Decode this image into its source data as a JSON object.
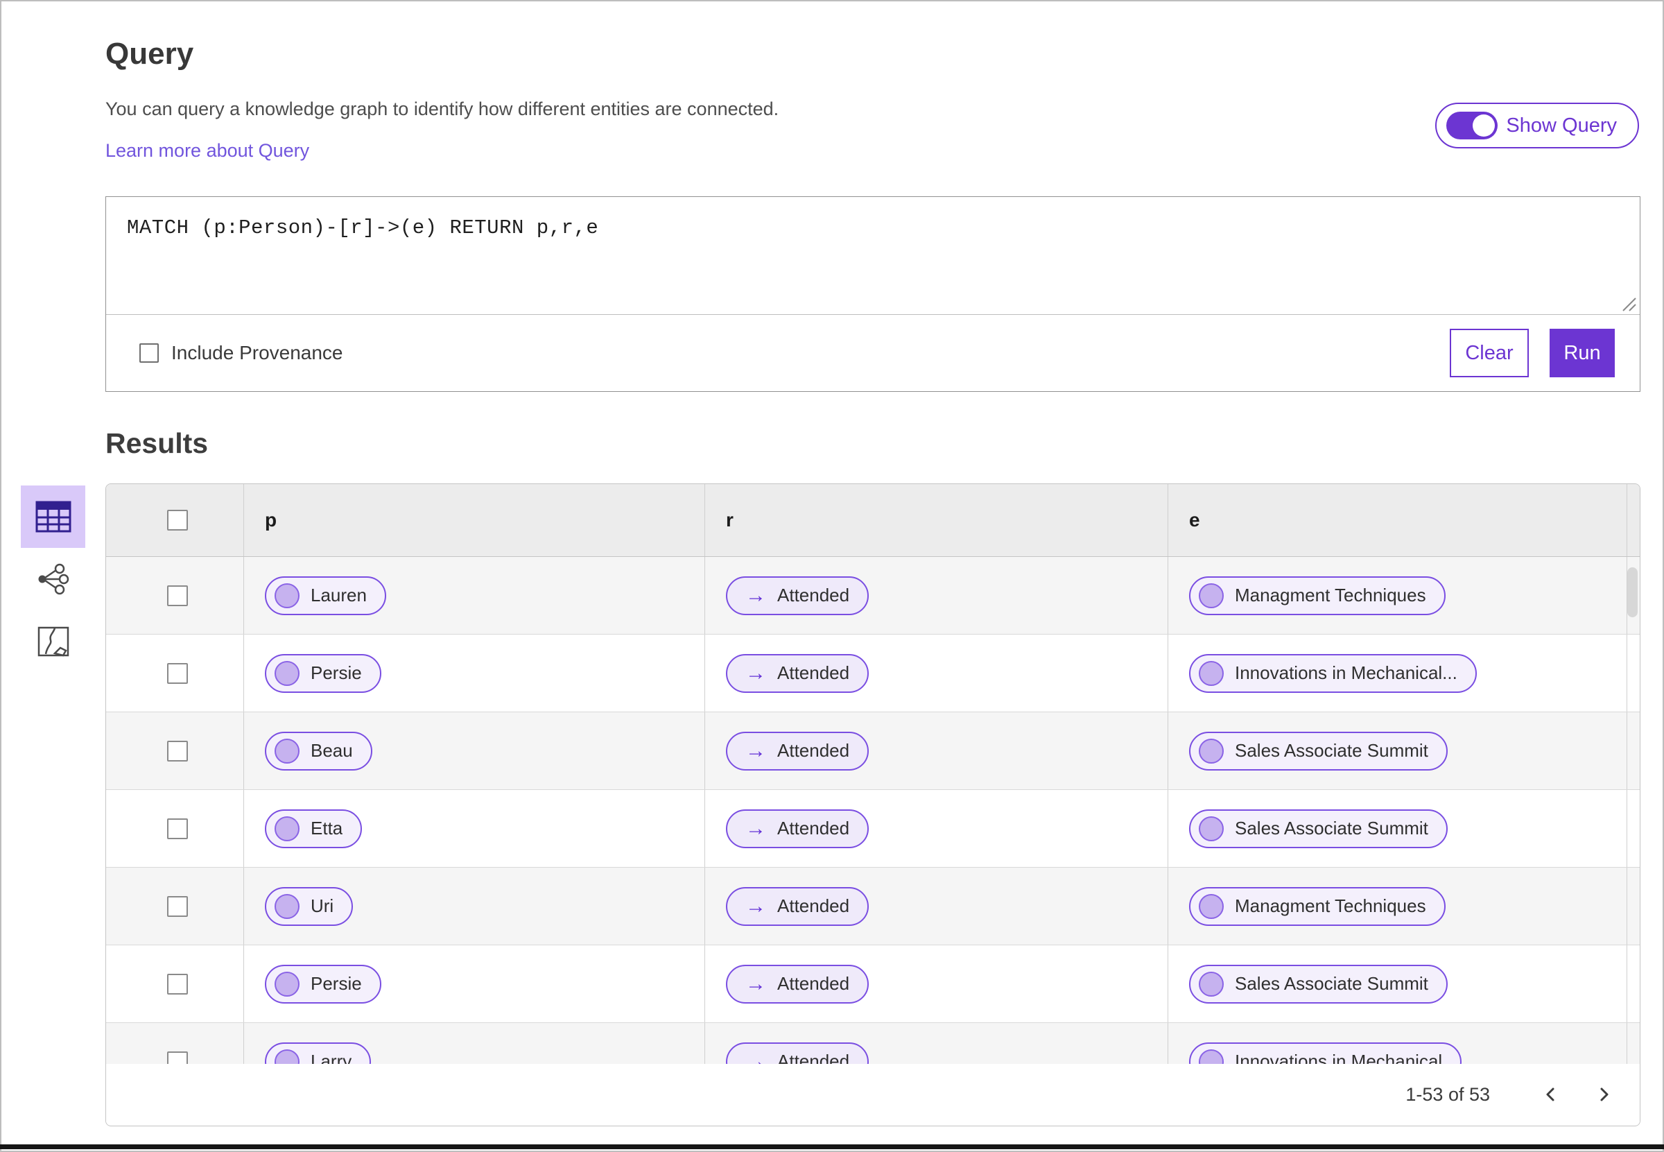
{
  "header": {
    "title": "Query",
    "description": "You can query a knowledge graph to identify how different entities are connected.",
    "learn_more_link": "Learn more about Query",
    "show_query_toggle": {
      "label": "Show Query",
      "state": "on"
    }
  },
  "query_editor": {
    "query_text": "MATCH (p:Person)-[r]->(e) RETURN p,r,e",
    "include_provenance": {
      "label": "Include Provenance",
      "checked": false
    },
    "buttons": {
      "clear": "Clear",
      "run": "Run"
    }
  },
  "results": {
    "heading": "Results",
    "views": [
      {
        "name": "table-view",
        "selected": true
      },
      {
        "name": "network-view",
        "selected": false
      },
      {
        "name": "map-view",
        "selected": false
      }
    ],
    "table": {
      "columns": [
        "p",
        "r",
        "e"
      ],
      "relation_arrow_glyph": "→",
      "rows": [
        {
          "p": "Lauren",
          "r": "Attended",
          "e": "Managment Techniques"
        },
        {
          "p": "Persie",
          "r": "Attended",
          "e": "Innovations in Mechanical..."
        },
        {
          "p": "Beau",
          "r": "Attended",
          "e": "Sales Associate Summit"
        },
        {
          "p": "Etta",
          "r": "Attended",
          "e": "Sales Associate Summit"
        },
        {
          "p": "Uri",
          "r": "Attended",
          "e": "Managment Techniques"
        },
        {
          "p": "Persie",
          "r": "Attended",
          "e": "Sales Associate Summit"
        },
        {
          "p": "Larry",
          "r": "Attended",
          "e": "Innovations in Mechanical"
        }
      ]
    },
    "pagination": {
      "range_label": "1-53 of 53"
    }
  },
  "colors": {
    "accent": "#6c35d2",
    "accent_light_bg": "#d9c9f9",
    "link": "#7155dd",
    "pill_border": "#7a4ee2",
    "pill_dot_fill": "#c6b2ef",
    "entity_pill_bg": "#f4f0fc",
    "relation_pill_bg": "#efeafa",
    "table_header_bg": "#ececec",
    "alt_row_bg": "#f5f5f5"
  }
}
